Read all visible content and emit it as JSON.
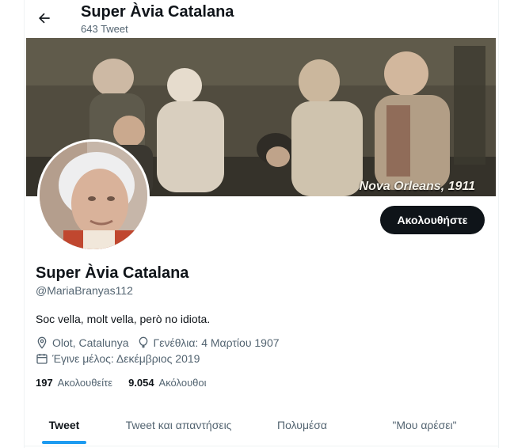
{
  "header": {
    "title": "Super Àvia Catalana",
    "tweet_count": "643 Tweet"
  },
  "banner": {
    "caption": "Nova Orleans, 1911"
  },
  "profile": {
    "follow_label": "Ακολουθήστε",
    "name": "Super Àvia Catalana",
    "handle": "@MariaBranyas112",
    "bio": "Soc vella, molt vella, però no idiota.",
    "location": "Olot, Catalunya",
    "birthday": "Γενέθλια: 4 Μαρτίου 1907",
    "joined": "Έγινε μέλος: Δεκέμβριος 2019",
    "following_count": "197",
    "following_label": "Ακολουθείτε",
    "followers_count": "9.054",
    "followers_label": "Ακόλουθοι"
  },
  "tabs": [
    {
      "label": "Tweet",
      "active": true
    },
    {
      "label": "Tweet και απαντήσεις",
      "active": false
    },
    {
      "label": "Πολυμέσα",
      "active": false
    },
    {
      "label": "\"Μου αρέσει\"",
      "active": false
    }
  ],
  "colors": {
    "accent": "#1d9bf0",
    "text": "#0f1419",
    "secondary": "#536471"
  }
}
